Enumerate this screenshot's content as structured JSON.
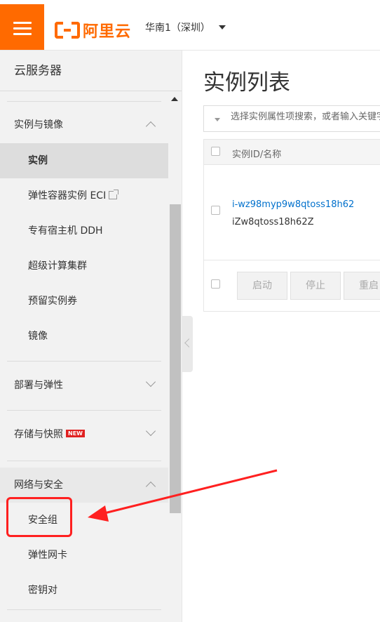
{
  "topbar": {
    "brand": "阿里云",
    "region": "华南1（深圳）"
  },
  "sidebar": {
    "title": "云服务器",
    "groups": [
      {
        "label": "实例与镜像",
        "expanded": true,
        "items": [
          {
            "label": "实例",
            "active": true
          },
          {
            "label": "弹性容器实例 ECI",
            "external": true
          },
          {
            "label": "专有宿主机 DDH"
          },
          {
            "label": "超级计算集群"
          },
          {
            "label": "预留实例券"
          },
          {
            "label": "镜像"
          }
        ]
      },
      {
        "label": "部署与弹性",
        "expanded": false
      },
      {
        "label": "存储与快照",
        "expanded": false,
        "badge": "NEW"
      },
      {
        "label": "网络与安全",
        "expanded": true,
        "items": [
          {
            "label": "安全组",
            "highlighted": true
          },
          {
            "label": "弹性网卡"
          },
          {
            "label": "密钥对"
          }
        ]
      }
    ]
  },
  "main": {
    "title": "实例列表",
    "search_placeholder": "选择实例属性项搜索，或者输入关键字识别搜索",
    "table": {
      "column_header": "实例ID/名称",
      "rows": [
        {
          "id": "i-wz98myp9w8qtoss18h62",
          "name": "iZw8qtoss18h62Z"
        }
      ],
      "actions": [
        "启动",
        "停止",
        "重启"
      ]
    }
  },
  "colors": {
    "brand": "#ff6a00",
    "link": "#0070cc",
    "annotation": "#ff2020"
  }
}
